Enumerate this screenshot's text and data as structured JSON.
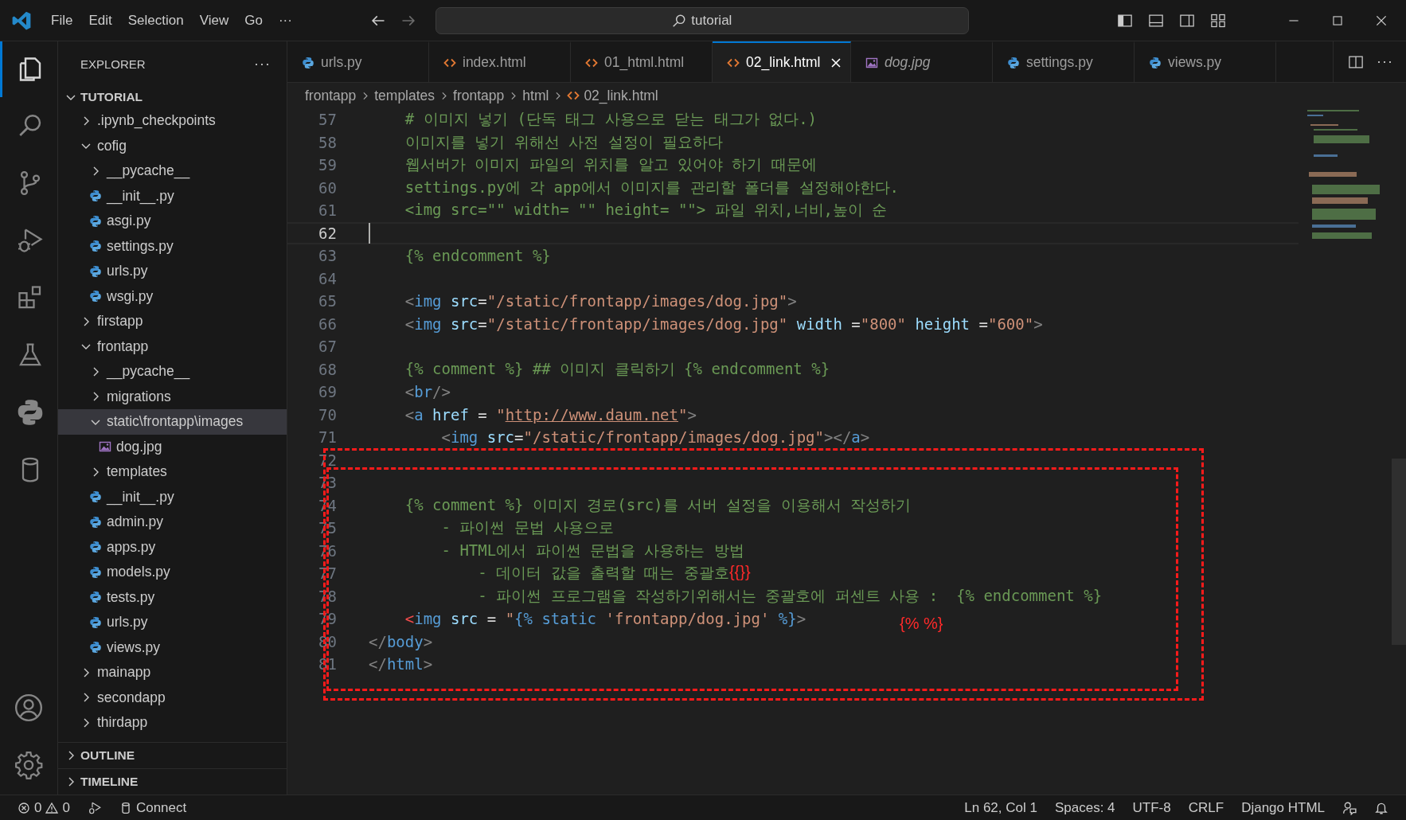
{
  "title_bar": {
    "menus": [
      "File",
      "Edit",
      "Selection",
      "View",
      "Go",
      "···"
    ],
    "search": "tutorial"
  },
  "activity_bar": [
    {
      "kind": "files",
      "selected": true
    },
    {
      "kind": "search",
      "selected": false
    },
    {
      "kind": "source",
      "selected": false
    },
    {
      "kind": "debug",
      "selected": false
    },
    {
      "kind": "extensions",
      "selected": false
    },
    {
      "kind": "flask",
      "selected": false
    },
    {
      "kind": "python",
      "selected": false
    },
    {
      "kind": "database",
      "selected": false
    }
  ],
  "sidebar": {
    "title": "EXPLORER",
    "more": "···",
    "section": {
      "label": "TUTORIAL",
      "expanded": true
    },
    "tree": [
      {
        "label": ".ipynb_checkpoints",
        "kind": "folder",
        "expanded": false,
        "selected": false
      },
      {
        "label": "cofig",
        "kind": "folder",
        "expanded": true,
        "selected": false,
        "children": [
          {
            "label": "__pycache__",
            "kind": "folder",
            "expanded": false,
            "selected": false
          },
          {
            "label": "__init__.py",
            "kind": "python",
            "selected": false
          },
          {
            "label": "asgi.py",
            "kind": "python",
            "selected": false
          },
          {
            "label": "settings.py",
            "kind": "python",
            "selected": false
          },
          {
            "label": "urls.py",
            "kind": "python",
            "selected": false
          },
          {
            "label": "wsgi.py",
            "kind": "python",
            "selected": false
          }
        ]
      },
      {
        "label": "firstapp",
        "kind": "folder",
        "expanded": false,
        "selected": false
      },
      {
        "label": "frontapp",
        "kind": "folder",
        "expanded": true,
        "selected": false,
        "children": [
          {
            "label": "__pycache__",
            "kind": "folder",
            "expanded": false,
            "selected": false
          },
          {
            "label": "migrations",
            "kind": "folder",
            "expanded": false,
            "selected": false
          },
          {
            "label": "static\\frontapp\\images",
            "kind": "folder",
            "expanded": true,
            "selected": true,
            "children": [
              {
                "label": "dog.jpg",
                "kind": "image",
                "selected": false
              }
            ]
          },
          {
            "label": "templates",
            "kind": "folder",
            "expanded": false,
            "selected": false
          },
          {
            "label": "__init__.py",
            "kind": "python",
            "selected": false
          },
          {
            "label": "admin.py",
            "kind": "python",
            "selected": false
          },
          {
            "label": "apps.py",
            "kind": "python",
            "selected": false
          },
          {
            "label": "models.py",
            "kind": "python",
            "selected": false
          },
          {
            "label": "tests.py",
            "kind": "python",
            "selected": false
          },
          {
            "label": "urls.py",
            "kind": "python",
            "selected": false
          },
          {
            "label": "views.py",
            "kind": "python",
            "selected": false
          }
        ]
      },
      {
        "label": "mainapp",
        "kind": "folder",
        "expanded": false,
        "selected": false
      },
      {
        "label": "secondapp",
        "kind": "folder",
        "expanded": false,
        "selected": false
      },
      {
        "label": "thirdapp",
        "kind": "folder",
        "expanded": false,
        "selected": false
      }
    ],
    "panels": [
      {
        "label": "OUTLINE",
        "expanded": false
      },
      {
        "label": "TIMELINE",
        "expanded": false
      }
    ]
  },
  "tabs": [
    {
      "label": "urls.py",
      "kind": "python",
      "selected": false,
      "preview": false
    },
    {
      "label": "index.html",
      "kind": "html",
      "selected": false,
      "preview": false
    },
    {
      "label": "01_html.html",
      "kind": "html",
      "selected": false,
      "preview": false
    },
    {
      "label": "02_link.html",
      "kind": "html",
      "selected": true,
      "preview": false
    },
    {
      "label": "dog.jpg",
      "kind": "image",
      "selected": false,
      "preview": true
    },
    {
      "label": "settings.py",
      "kind": "python",
      "selected": false,
      "preview": false
    },
    {
      "label": "views.py",
      "kind": "python",
      "selected": false,
      "preview": false
    }
  ],
  "breadcrumbs": [
    "frontapp",
    "templates",
    "frontapp",
    "html",
    "02_link.html"
  ],
  "code": [
    {
      "number": "57",
      "current": false,
      "tokens": [
        {
          "kind": "comment",
          "text": "    # 이미지 넣기 (단독 태그 사용으로 닫는 태그가 없다.)"
        }
      ]
    },
    {
      "number": "58",
      "current": false,
      "tokens": [
        {
          "kind": "comment",
          "text": "    이미지를 넣기 위해선 사전 설정이 필요하다"
        }
      ]
    },
    {
      "number": "59",
      "current": false,
      "tokens": [
        {
          "kind": "comment",
          "text": "    웹서버가 이미지 파일의 위치를 알고 있어야 하기 때문에"
        }
      ]
    },
    {
      "number": "60",
      "current": false,
      "tokens": [
        {
          "kind": "comment",
          "text": "    settings.py에 각 app에서 이미지를 관리할 폴더를 설정해야한다."
        }
      ]
    },
    {
      "number": "61",
      "current": false,
      "tokens": [
        {
          "kind": "comment",
          "text": "    <img src=\"\" width= \"\" height= \"\"> 파일 위치,너비,높이 순"
        }
      ]
    },
    {
      "number": "62",
      "current": true
    },
    {
      "number": "63",
      "current": false,
      "tokens": [
        {
          "kind": "comment",
          "text": "    {% endcomment %}"
        }
      ]
    },
    {
      "number": "64",
      "current": false
    },
    {
      "number": "65",
      "current": false,
      "tokens": [
        {
          "kind": "punct",
          "text": "    <"
        },
        {
          "kind": "tag",
          "text": "img"
        },
        {
          "kind": "attr",
          "text": " src"
        },
        {
          "kind": "plain",
          "text": "="
        },
        {
          "kind": "string",
          "text": "\"/static/frontapp/images/dog.jpg\""
        },
        {
          "kind": "punct",
          "text": ">"
        }
      ]
    },
    {
      "number": "66",
      "current": false,
      "tokens": [
        {
          "kind": "punct",
          "text": "    <"
        },
        {
          "kind": "tag",
          "text": "img"
        },
        {
          "kind": "attr",
          "text": " src"
        },
        {
          "kind": "plain",
          "text": "="
        },
        {
          "kind": "string",
          "text": "\"/static/frontapp/images/dog.jpg\""
        },
        {
          "kind": "attr",
          "text": " width"
        },
        {
          "kind": "plain",
          "text": " ="
        },
        {
          "kind": "string",
          "text": "\"800\""
        },
        {
          "kind": "attr",
          "text": " height"
        },
        {
          "kind": "plain",
          "text": " ="
        },
        {
          "kind": "string",
          "text": "\"600\""
        },
        {
          "kind": "punct",
          "text": ">"
        }
      ]
    },
    {
      "number": "67",
      "current": false
    },
    {
      "number": "68",
      "current": false,
      "tokens": [
        {
          "kind": "comment",
          "text": "    {% comment %} ## 이미지 클릭하기 {% endcomment %}"
        }
      ]
    },
    {
      "number": "69",
      "current": false,
      "tokens": [
        {
          "kind": "punct",
          "text": "    <"
        },
        {
          "kind": "tag",
          "text": "br"
        },
        {
          "kind": "punct",
          "text": "/>"
        }
      ]
    },
    {
      "number": "70",
      "current": false,
      "tokens": [
        {
          "kind": "punct",
          "text": "    <"
        },
        {
          "kind": "tag",
          "text": "a"
        },
        {
          "kind": "attr",
          "text": " href"
        },
        {
          "kind": "plain",
          "text": " = "
        },
        {
          "kind": "string",
          "text": "\""
        },
        {
          "kind": "link",
          "text": "http://www.daum.net"
        },
        {
          "kind": "string",
          "text": "\""
        },
        {
          "kind": "punct",
          "text": ">"
        }
      ]
    },
    {
      "number": "71",
      "current": false,
      "tokens": [
        {
          "kind": "punct",
          "text": "        <"
        },
        {
          "kind": "tag",
          "text": "img"
        },
        {
          "kind": "attr",
          "text": " src"
        },
        {
          "kind": "plain",
          "text": "="
        },
        {
          "kind": "string",
          "text": "\"/static/frontapp/images/dog.jpg\""
        },
        {
          "kind": "punct",
          "text": "></"
        },
        {
          "kind": "tag",
          "text": "a"
        },
        {
          "kind": "punct",
          "text": ">"
        }
      ]
    },
    {
      "number": "72",
      "current": false
    },
    {
      "number": "73",
      "current": false
    },
    {
      "number": "74",
      "current": false,
      "tokens": [
        {
          "kind": "comment",
          "text": "    {% comment %} 이미지 경로(src)를 서버 설정을 이용해서 작성하기"
        }
      ]
    },
    {
      "number": "75",
      "current": false,
      "tokens": [
        {
          "kind": "comment",
          "text": "        - 파이썬 문법 사용으로"
        }
      ]
    },
    {
      "number": "76",
      "current": false,
      "tokens": [
        {
          "kind": "comment",
          "text": "        - HTML에서 파이썬 문법을 사용하는 방법"
        }
      ]
    },
    {
      "number": "77",
      "current": false,
      "tokens": [
        {
          "kind": "comment",
          "text": "            - 데이터 값을 출력할 때는 중괄호"
        },
        {
          "kind": "note",
          "text": "{{}}"
        }
      ]
    },
    {
      "number": "78",
      "current": false,
      "tokens": [
        {
          "kind": "comment",
          "text": "            - 파이썬 프로그램을 작성하기위해서는 중괄호에 퍼센트 사용 :  {% endcomment %}"
        }
      ]
    },
    {
      "number": "79",
      "current": false,
      "tokens": [
        {
          "kind": "error",
          "text": "    <"
        },
        {
          "kind": "tag",
          "text": "img"
        },
        {
          "kind": "attr",
          "text": " src"
        },
        {
          "kind": "plain",
          "text": " = "
        },
        {
          "kind": "string",
          "text": "\""
        },
        {
          "kind": "tag",
          "text": "{% static"
        },
        {
          "kind": "string",
          "text": " 'frontapp/dog.jpg'"
        },
        {
          "kind": "tag",
          "text": " %}"
        },
        {
          "kind": "punct",
          "text": ">"
        }
      ]
    },
    {
      "number": "80",
      "current": false,
      "tokens": [
        {
          "kind": "punct",
          "text": "</"
        },
        {
          "kind": "tag",
          "text": "body"
        },
        {
          "kind": "punct",
          "text": ">"
        }
      ]
    },
    {
      "number": "81",
      "current": false,
      "tokens": [
        {
          "kind": "punct",
          "text": "</"
        },
        {
          "kind": "tag",
          "text": "html"
        },
        {
          "kind": "punct",
          "text": ">"
        }
      ]
    }
  ],
  "floating_note": "{% %}",
  "status_bar": {
    "errors": "0",
    "warnings": "0",
    "connect": "Connect",
    "right": [
      "Ln 62, Col 1",
      "Spaces: 4",
      "UTF-8",
      "CRLF",
      "Django HTML"
    ]
  }
}
